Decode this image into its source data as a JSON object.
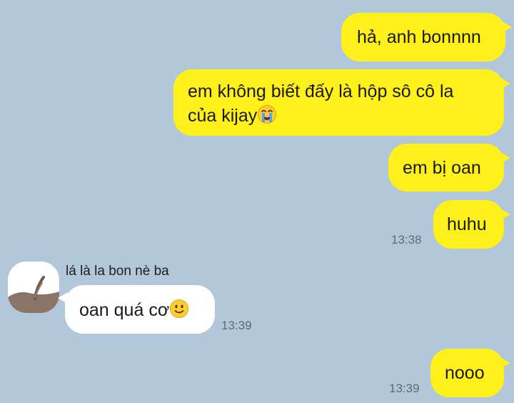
{
  "colors": {
    "background": "#b2c7da",
    "outgoing_bubble": "#fef01b",
    "incoming_bubble": "#ffffff"
  },
  "messages": {
    "m1": {
      "text": "hả, anh bonnnn"
    },
    "m2": {
      "line1": "em không biết đấy là hộp sô cô la",
      "line2": "của kijay",
      "emoji": "loudly-crying-face-icon"
    },
    "m3": {
      "text": "em bị oan"
    },
    "m4": {
      "text": "huhu",
      "time": "13:38"
    },
    "m5": {
      "sender": "lá là la bon nè ba",
      "text": "oan quá cơ",
      "emoji": "slightly-smiling-face-icon",
      "time": "13:39"
    },
    "m6": {
      "text": "nooo",
      "time": "13:39"
    }
  }
}
